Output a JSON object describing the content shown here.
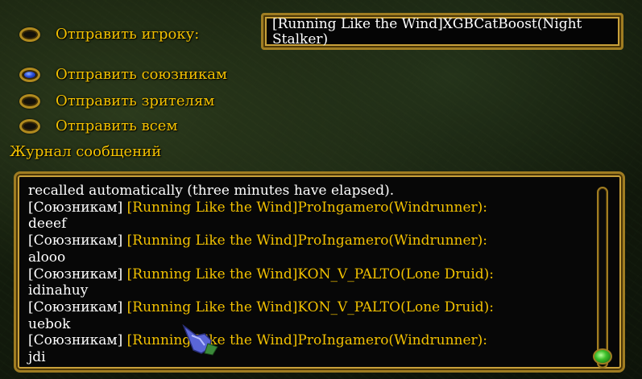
{
  "send_options": [
    {
      "label": "Отправить игроку:",
      "selected": false
    },
    {
      "label": "Отправить союзникам",
      "selected": true
    },
    {
      "label": "Отправить зрителям",
      "selected": false
    },
    {
      "label": "Отправить всем",
      "selected": false
    }
  ],
  "player_field": {
    "value": "[Running Like the Wind]XGBCatBoost(Night Stalker)"
  },
  "log": {
    "title": "Журнал сообщений",
    "lines": [
      {
        "prefix": "",
        "sender": "",
        "text": "recalled automatically (three minutes have elapsed)."
      },
      {
        "prefix": "[Союзникам] ",
        "sender": "[Running Like the Wind]ProIngamero(Windrunner):",
        "text": ""
      },
      {
        "prefix": "",
        "sender": "",
        "text": "deeef"
      },
      {
        "prefix": "[Союзникам] ",
        "sender": "[Running Like the Wind]ProIngamero(Windrunner):",
        "text": ""
      },
      {
        "prefix": "",
        "sender": "",
        "text": "alooo"
      },
      {
        "prefix": "[Союзникам] ",
        "sender": "[Running Like the Wind]KON_V_PALTO(Lone Druid):",
        "text": ""
      },
      {
        "prefix": "",
        "sender": "",
        "text": "idinahuy"
      },
      {
        "prefix": "[Союзникам] ",
        "sender": "[Running Like the Wind]KON_V_PALTO(Lone Druid):",
        "text": ""
      },
      {
        "prefix": "",
        "sender": "",
        "text": "uebok"
      },
      {
        "prefix": "[Союзникам] ",
        "sender": "[Running Like the Wind]ProIngamero(Windrunner):",
        "text": ""
      },
      {
        "prefix": "",
        "sender": "",
        "text": "jdi"
      }
    ]
  },
  "icons": {
    "cursor": "gauntlet-cursor-icon"
  },
  "colors": {
    "gold_text": "#f2c100",
    "white_text": "#ffffff",
    "frame": "#a07d22"
  }
}
